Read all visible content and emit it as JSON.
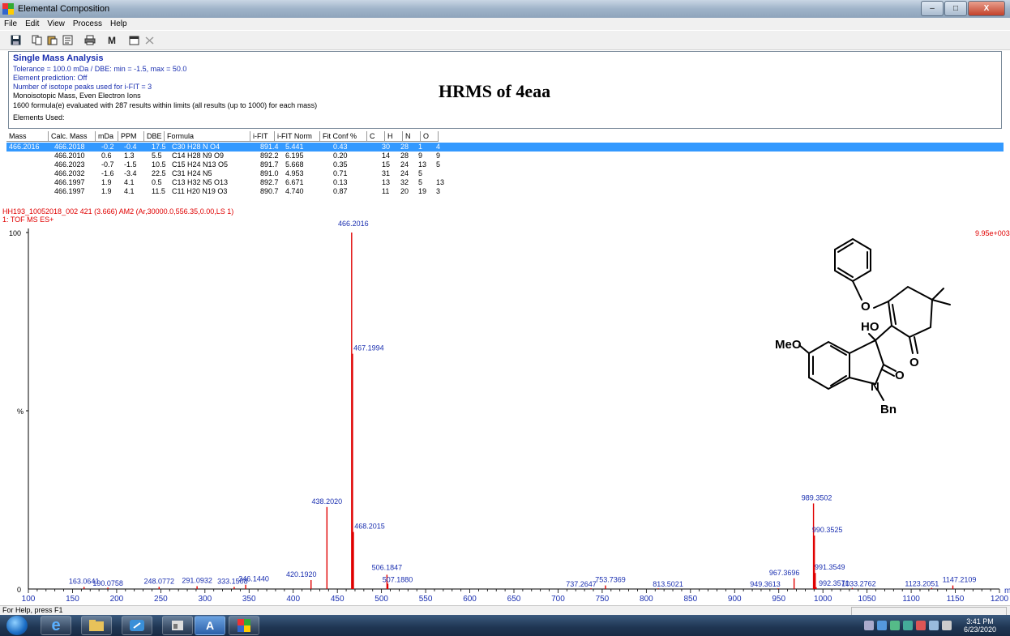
{
  "window": {
    "title": "Elemental Composition",
    "min": "–",
    "max": "□",
    "close": "X"
  },
  "menu": [
    "File",
    "Edit",
    "View",
    "Process",
    "Help"
  ],
  "toolbar": {
    "icons": [
      "save-icon",
      "copy-icon",
      "paste-icon",
      "properties-icon",
      "print-icon",
      "m-icon",
      "window-icon",
      "close-x-icon"
    ],
    "m_label": "M"
  },
  "summary": {
    "title": "Single Mass Analysis",
    "tolerance": "Tolerance = 100.0 mDa   /   DBE: min = -1.5, max = 50.0",
    "prediction": "Element prediction: Off",
    "isotope": "Number of isotope peaks used for i-FIT = 3",
    "mode": "Monoisotopic Mass, Even Electron Ions",
    "evaluated": "1600 formula(e) evaluated with 287 results within limits (all results (up to 1000) for each mass)",
    "elements": "Elements Used:",
    "annotation": "HRMS of 4eaa"
  },
  "results": {
    "columns": [
      "Mass",
      "Calc. Mass",
      "mDa",
      "PPM",
      "DBE",
      "Formula",
      "i-FIT",
      "i-FIT Norm",
      "Fit Conf %",
      "C",
      "H",
      "N",
      "O"
    ],
    "rows": [
      {
        "mass": "466.2016",
        "calc": "466.2018",
        "mda": "-0.2",
        "ppm": "-0.4",
        "dbe": "17.5",
        "formula": "C30 H28 N O4",
        "ifit": "891.4",
        "norm": "5.441",
        "conf": "0.43",
        "c": "30",
        "h": "28",
        "n": "1",
        "o": "4"
      },
      {
        "mass": "",
        "calc": "466.2010",
        "mda": "0.6",
        "ppm": "1.3",
        "dbe": "5.5",
        "formula": "C14 H28 N9 O9",
        "ifit": "892.2",
        "norm": "6.195",
        "conf": "0.20",
        "c": "14",
        "h": "28",
        "n": "9",
        "o": "9"
      },
      {
        "mass": "",
        "calc": "466.2023",
        "mda": "-0.7",
        "ppm": "-1.5",
        "dbe": "10.5",
        "formula": "C15 H24 N13 O5",
        "ifit": "891.7",
        "norm": "5.668",
        "conf": "0.35",
        "c": "15",
        "h": "24",
        "n": "13",
        "o": "5"
      },
      {
        "mass": "",
        "calc": "466.2032",
        "mda": "-1.6",
        "ppm": "-3.4",
        "dbe": "22.5",
        "formula": "C31 H24 N5",
        "ifit": "891.0",
        "norm": "4.953",
        "conf": "0.71",
        "c": "31",
        "h": "24",
        "n": "5",
        "o": ""
      },
      {
        "mass": "",
        "calc": "466.1997",
        "mda": "1.9",
        "ppm": "4.1",
        "dbe": "0.5",
        "formula": "C13 H32 N5 O13",
        "ifit": "892.7",
        "norm": "6.671",
        "conf": "0.13",
        "c": "13",
        "h": "32",
        "n": "5",
        "o": "13"
      },
      {
        "mass": "",
        "calc": "466.1997",
        "mda": "1.9",
        "ppm": "4.1",
        "dbe": "11.5",
        "formula": "C11 H20 N19 O3",
        "ifit": "890.7",
        "norm": "4.740",
        "conf": "0.87",
        "c": "11",
        "h": "20",
        "n": "19",
        "o": "3"
      }
    ]
  },
  "spectrum": {
    "header1": "HH193_10052018_002 421 (3.666) AM2 (Ar,30000.0,556.35,0.00,LS 1)",
    "header2": "1: TOF MS ES+",
    "intensity_max": "9.95e+003",
    "y_label_top": "100",
    "y_label_mid": "%",
    "y_label_bottom": "0",
    "x_unit": "m/z",
    "colors": {
      "peaks": "#e00000",
      "labels": "#1a2fb0",
      "axis": "#000000"
    }
  },
  "chart_data": {
    "type": "bar",
    "title": "HH193_10052018_002 421 (3.666) AM2 (Ar,30000.0,556.35,0.00,LS 1)",
    "xlabel": "m/z",
    "ylabel": "%",
    "xlim": [
      100,
      1200
    ],
    "ylim": [
      0,
      100
    ],
    "xticks": [
      100,
      150,
      200,
      250,
      300,
      350,
      400,
      450,
      500,
      550,
      600,
      650,
      700,
      750,
      800,
      850,
      900,
      950,
      1000,
      1050,
      1100,
      1150,
      1200
    ],
    "peaks": [
      {
        "mz": 163.0641,
        "intensity": 0.6,
        "label": "163.0641"
      },
      {
        "mz": 190.0758,
        "intensity": 0.4,
        "label": "190.0758"
      },
      {
        "mz": 248.0772,
        "intensity": 0.6,
        "label": "248.0772"
      },
      {
        "mz": 291.0932,
        "intensity": 0.8,
        "label": "291.0932"
      },
      {
        "mz": 333.1508,
        "intensity": 0.6,
        "label": "333.1508"
      },
      {
        "mz": 346.144,
        "intensity": 1.2,
        "label": "346.1440"
      },
      {
        "mz": 420.192,
        "intensity": 2.5,
        "label": "420.1920"
      },
      {
        "mz": 438.202,
        "intensity": 23.0,
        "label": "438.2020"
      },
      {
        "mz": 466.2016,
        "intensity": 100.0,
        "label": "466.2016"
      },
      {
        "mz": 467.1994,
        "intensity": 66.0,
        "label": "467.1994"
      },
      {
        "mz": 468.2015,
        "intensity": 16.0,
        "label": "468.2015"
      },
      {
        "mz": 506.1847,
        "intensity": 4.0,
        "label": "506.1847"
      },
      {
        "mz": 507.188,
        "intensity": 1.5,
        "label": "507.1880"
      },
      {
        "mz": 737.2647,
        "intensity": 0.2,
        "label": "737.2647"
      },
      {
        "mz": 753.7369,
        "intensity": 1.0,
        "label": "753.7369"
      },
      {
        "mz": 813.5021,
        "intensity": 0.2,
        "label": "813.5021"
      },
      {
        "mz": 949.3613,
        "intensity": 0.2,
        "label": "949.3613"
      },
      {
        "mz": 967.3696,
        "intensity": 3.0,
        "label": "967.3696"
      },
      {
        "mz": 989.3502,
        "intensity": 24.0,
        "label": "989.3502"
      },
      {
        "mz": 990.3525,
        "intensity": 15.0,
        "label": "990.3525"
      },
      {
        "mz": 991.3549,
        "intensity": 4.5,
        "label": "991.3549"
      },
      {
        "mz": 992.3571,
        "intensity": 0.5,
        "label": "992.3571"
      },
      {
        "mz": 1033.2762,
        "intensity": 0.3,
        "label": "1033.2762"
      },
      {
        "mz": 1123.2051,
        "intensity": 0.3,
        "label": "1123.2051"
      },
      {
        "mz": 1147.2109,
        "intensity": 1.0,
        "label": "1147.2109"
      }
    ]
  },
  "structure": {
    "labels": [
      "MeO",
      "HO",
      "O",
      "O",
      "O",
      "N",
      "Bn"
    ]
  },
  "status": {
    "help": "For Help, press F1"
  },
  "taskbar": {
    "apps": [
      "ie-icon",
      "explorer-icon",
      "app-icon",
      "file-icon",
      "A",
      "elemental-icon"
    ],
    "time": "3:41 PM",
    "date": "6/23/2020"
  }
}
